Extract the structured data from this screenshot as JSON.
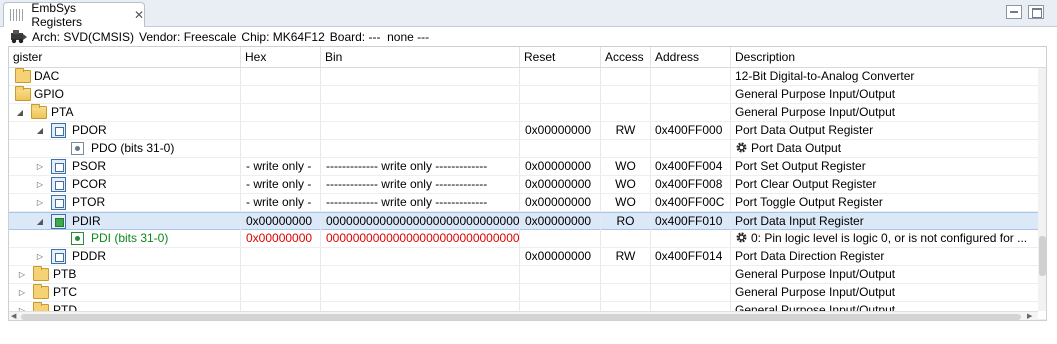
{
  "view": {
    "tab_title": "EmbSys Registers",
    "close_glyph": "✕",
    "icons": [
      "grip-icon",
      "close-icon",
      "minimize-icon",
      "maximize-icon"
    ]
  },
  "infobar": {
    "arch": "Arch: SVD(CMSIS)",
    "vendor": "Vendor: Freescale",
    "chip": "Chip: MK64F12",
    "board": "Board: ---  none ---"
  },
  "columns": {
    "register": "gister",
    "hex": "Hex",
    "bin": "Bin",
    "reset": "Reset",
    "access": "Access",
    "address": "Address",
    "description": "Description"
  },
  "colors": {
    "selected_row": "#dbe8f7",
    "changed_value": "#e00000",
    "changed_field": "#0a8a1a"
  },
  "rows": [
    {
      "name": "DAC",
      "desc": "12-Bit Digital-to-Analog Converter"
    },
    {
      "name": "GPIO",
      "desc": "General Purpose Input/Output"
    },
    {
      "name": "PTA",
      "desc": "General Purpose Input/Output"
    },
    {
      "name": "PDOR",
      "reset": "0x00000000",
      "access": "RW",
      "address": "0x400FF000",
      "desc": "Port Data Output Register"
    },
    {
      "name": "PDO (bits 31-0)",
      "desc": "Port Data Output"
    },
    {
      "name": "PSOR",
      "hex": "- write only -",
      "bin": "------------- write only -------------",
      "reset": "0x00000000",
      "access": "WO",
      "address": "0x400FF004",
      "desc": "Port Set Output Register"
    },
    {
      "name": "PCOR",
      "hex": "- write only -",
      "bin": "------------- write only -------------",
      "reset": "0x00000000",
      "access": "WO",
      "address": "0x400FF008",
      "desc": "Port Clear Output Register"
    },
    {
      "name": "PTOR",
      "hex": "- write only -",
      "bin": "------------- write only -------------",
      "reset": "0x00000000",
      "access": "WO",
      "address": "0x400FF00C",
      "desc": "Port Toggle Output Register"
    },
    {
      "name": "PDIR",
      "hex": "0x00000000",
      "bin": "00000000000000000000000000000000",
      "reset": "0x00000000",
      "access": "RO",
      "address": "0x400FF010",
      "desc": "Port Data Input Register"
    },
    {
      "name": "PDI (bits 31-0)",
      "hex": "0x00000000",
      "bin": "00000000000000000000000000000000",
      "desc": "0: Pin logic level is logic 0, or is not configured for ..."
    },
    {
      "name": "PDDR",
      "reset": "0x00000000",
      "access": "RW",
      "address": "0x400FF014",
      "desc": "Port Data Direction Register"
    },
    {
      "name": "PTB",
      "desc": "General Purpose Input/Output"
    },
    {
      "name": "PTC",
      "desc": "General Purpose Input/Output"
    },
    {
      "name": "PTD",
      "desc": "General Purpose Input/Output"
    }
  ]
}
